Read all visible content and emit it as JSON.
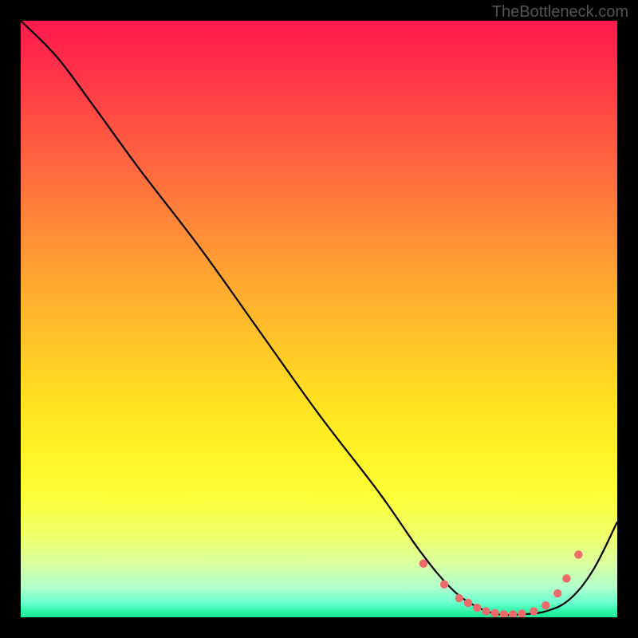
{
  "watermark": "TheBottleneck.com",
  "chart_data": {
    "type": "line",
    "title": "",
    "xlabel": "",
    "ylabel": "",
    "xlim": [
      0,
      100
    ],
    "ylim": [
      0,
      100
    ],
    "series": [
      {
        "name": "bottleneck-curve",
        "x": [
          0,
          6,
          12,
          20,
          30,
          40,
          50,
          60,
          67,
          72,
          76,
          80,
          84,
          88,
          92,
          96,
          100
        ],
        "y": [
          100,
          94,
          86,
          75,
          62,
          48,
          34,
          21,
          11,
          5,
          2,
          0.5,
          0.5,
          1,
          3,
          8,
          16
        ]
      }
    ],
    "markers": {
      "name": "highlight-dots",
      "x": [
        67.5,
        71,
        73.5,
        75,
        76.5,
        78,
        79.5,
        81,
        82.5,
        84,
        86,
        88,
        90,
        91.5,
        93.5
      ],
      "y": [
        9,
        5.5,
        3.2,
        2.4,
        1.6,
        1.0,
        0.7,
        0.5,
        0.5,
        0.6,
        1.0,
        2.0,
        4.0,
        6.5,
        10.5
      ]
    },
    "gradient": {
      "top": "#ff1a4d",
      "mid_upper": "#ff8838",
      "mid": "#ffdf22",
      "mid_lower": "#f0ff66",
      "bottom": "#18e896"
    }
  }
}
